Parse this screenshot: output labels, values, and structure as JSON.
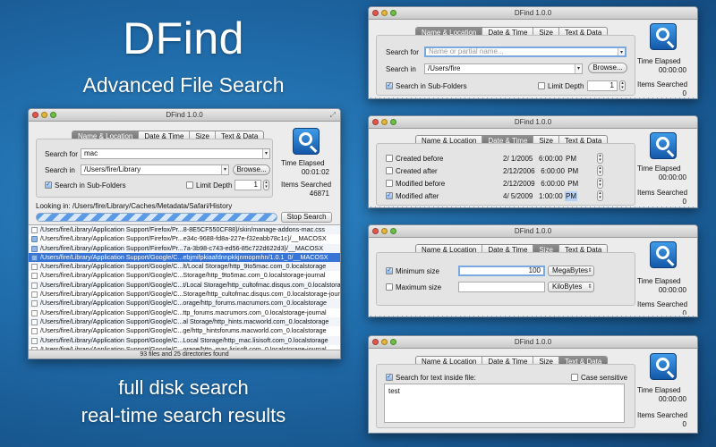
{
  "hero": {
    "title": "DFind",
    "subtitle": "Advanced File Search",
    "tagline1": "full disk search",
    "tagline2": "real-time search results"
  },
  "app_title": "DFind 1.0.0",
  "tabs": [
    "Name & Location",
    "Date & Time",
    "Size",
    "Text & Data"
  ],
  "stats": {
    "time_elapsed_label": "Time Elapsed",
    "items_searched_label": "Items Searched"
  },
  "main_window": {
    "search_for_label": "Search for",
    "search_for_value": "mac",
    "search_in_label": "Search in",
    "search_in_value": "/Users/fire/Library",
    "browse_label": "Browse...",
    "subfolders_label": "Search in Sub-Folders",
    "limit_depth_label": "Limit Depth",
    "limit_depth_value": "1",
    "time_elapsed_value": "00:01:02",
    "items_searched_value": "46871",
    "looking_in": "Looking in:  /Users/fire/Library/Caches/Metadata/Safari/History",
    "stop_label": "Stop Search",
    "results": [
      "/Users/fire/Library/Application Support/Firefox/Pr...8-8E5CF550CF88}/skin/manage-addons-mac.css",
      "/Users/fire/Library/Application Support/Firefox/Pr...e34c-9688-fd8a-227e-f32eabb78c1c}/__MACOSX",
      "/Users/fire/Library/Application Support/Firefox/Pr...7a-3b98-c743-ed56-85c722d622d3}/__MACOSX",
      "/Users/fire/Library/Application Support/Google/C...ebjmifpkiaafdnnpkkjnmopmhn/1.0.1_0/__MACOSX",
      "/Users/fire/Library/Application Support/Google/C...lt/Local Storage/http_9to5mac.com_0.localstorage",
      "/Users/fire/Library/Application Support/Google/C...Storage/http_9to5mac.com_0.localstorage-journal",
      "/Users/fire/Library/Application Support/Google/C...t/Local Storage/http_cultofmac.disqus.com_0.localstorage",
      "/Users/fire/Library/Application Support/Google/C...Storage/http_cultofmac.disqus.com_0.localstorage-journal",
      "/Users/fire/Library/Application Support/Google/C...orage/http_forums.macrumors.com_0.localstorage",
      "/Users/fire/Library/Application Support/Google/C...ttp_forums.macrumors.com_0.localstorage-journal",
      "/Users/fire/Library/Application Support/Google/C...al Storage/http_hints.macworld.com_0.localstorage",
      "/Users/fire/Library/Application Support/Google/C...ge/http_hintsforums.macworld.com_0.localstorage",
      "/Users/fire/Library/Application Support/Google/C...Local Storage/http_mac.lisisoft.com_0.localstorage",
      "/Users/fire/Library/Application Support/Google/C...orage/http_mac.lisisoft.com_0.localstorage-journal",
      "/Users/fire/Library/Application Support/Google/C...rage/http_macbookpro.disqus.com_0.localstorage"
    ],
    "status": "93 files and 25 directories found"
  },
  "name_window": {
    "search_for_label": "Search for",
    "search_for_placeholder": "Name or partial name...",
    "search_in_label": "Search in",
    "search_in_value": "/Users/fire",
    "browse_label": "Browse...",
    "subfolders_label": "Search in Sub-Folders",
    "limit_depth_label": "Limit Depth",
    "limit_depth_value": "1",
    "time_elapsed_value": "00:00:00",
    "items_searched_value": "0"
  },
  "date_window": {
    "rows": [
      {
        "label": "Created before",
        "date": "2/  1/2005",
        "time": "6:00:00",
        "ampm": "PM"
      },
      {
        "label": "Created after",
        "date": "2/12/2006",
        "time": "6:00:00",
        "ampm": "PM"
      },
      {
        "label": "Modified before",
        "date": "2/12/2009",
        "time": "6:00:00",
        "ampm": "PM"
      },
      {
        "label": "Modified after",
        "date": "4/  5/2009",
        "time": "1:00:00",
        "ampm": "PM"
      }
    ],
    "time_elapsed_value": "00:00:00",
    "items_searched_value": "0"
  },
  "size_window": {
    "min_label": "Minimum size",
    "min_value": "100",
    "min_unit": "MegaBytes",
    "max_label": "Maximum size",
    "max_value": "",
    "max_unit": "KiloBytes",
    "time_elapsed_value": "00:00:00",
    "items_searched_value": "0"
  },
  "text_window": {
    "search_text_label": "Search for text inside file:",
    "case_label": "Case sensitive",
    "text_value": "test",
    "time_elapsed_value": "00:00:00",
    "items_searched_value": "0"
  }
}
